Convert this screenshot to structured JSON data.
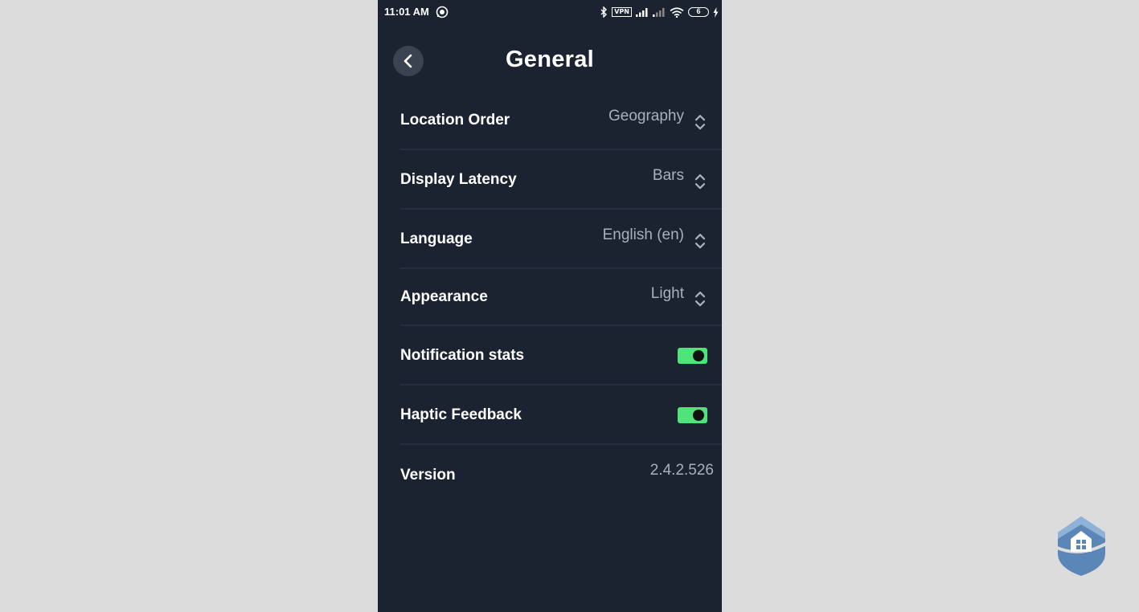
{
  "status_bar": {
    "time": "11:01 AM",
    "vpn": "VPN",
    "battery": "6"
  },
  "header": {
    "title": "General",
    "back_icon": "chevron-left-icon"
  },
  "settings": {
    "location_order": {
      "label": "Location Order",
      "value": "Geography"
    },
    "display_latency": {
      "label": "Display Latency",
      "value": "Bars"
    },
    "language": {
      "label": "Language",
      "value": "English (en)"
    },
    "appearance": {
      "label": "Appearance",
      "value": "Light"
    },
    "notification_stats": {
      "label": "Notification stats",
      "enabled": true
    },
    "haptic_feedback": {
      "label": "Haptic Feedback",
      "enabled": true
    },
    "version": {
      "label": "Version",
      "value": "2.4.2.526"
    }
  },
  "colors": {
    "background": "#1b2331",
    "toggle_on": "#4ee37b",
    "value_text": "#aab0ba",
    "page_backdrop": "#dcdcdc"
  }
}
